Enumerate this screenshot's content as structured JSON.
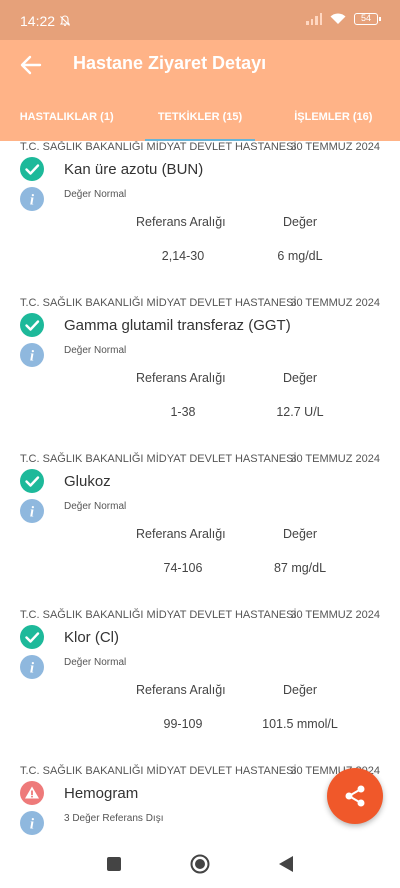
{
  "status_bar": {
    "time": "14:22",
    "battery": "54"
  },
  "header": {
    "title": "Hastane Ziyaret Detayı",
    "background": "#FFB387"
  },
  "tabs": [
    {
      "label": "HASTALIKLAR (1)",
      "active": false
    },
    {
      "label": "TETKİKLER (15)",
      "active": true
    },
    {
      "label": "İŞLEMLER (16)",
      "active": false
    }
  ],
  "labels": {
    "reference_range": "Referans Aralığı",
    "value": "Değer"
  },
  "tests": [
    {
      "hospital": "T.C. SAĞLIK BAKANLIĞI MİDYAT DEVLET HASTANESİ",
      "date": "30 TEMMUZ 2024",
      "name": "Kan üre azotu (BUN)",
      "status": "Değer Normal",
      "status_type": "normal",
      "reference_range": "2,14-30",
      "value": "6 mg/dL"
    },
    {
      "hospital": "T.C. SAĞLIK BAKANLIĞI MİDYAT DEVLET HASTANESİ",
      "date": "30 TEMMUZ 2024",
      "name": "Gamma glutamil transferaz (GGT)",
      "status": "Değer Normal",
      "status_type": "normal",
      "reference_range": "1-38",
      "value": "12.7 U/L"
    },
    {
      "hospital": "T.C. SAĞLIK BAKANLIĞI MİDYAT DEVLET HASTANESİ",
      "date": "30 TEMMUZ 2024",
      "name": "Glukoz",
      "status": "Değer Normal",
      "status_type": "normal",
      "reference_range": "74-106",
      "value": "87 mg/dL"
    },
    {
      "hospital": "T.C. SAĞLIK BAKANLIĞI MİDYAT DEVLET HASTANESİ",
      "date": "30 TEMMUZ 2024",
      "name": "Klor (Cl)",
      "status": "Değer Normal",
      "status_type": "normal",
      "reference_range": "99-109",
      "value": "101.5 mmol/L"
    },
    {
      "hospital": "T.C. SAĞLIK BAKANLIĞI MİDYAT DEVLET HASTANESİ",
      "date": "30 TEMMUZ 2024",
      "name": "Hemogram",
      "status": "3 Değer Referans Dışı",
      "status_type": "warning",
      "reference_range": "",
      "value": ""
    }
  ],
  "colors": {
    "normal_icon": "#1DB99A",
    "warning_icon": "#EE7A7A",
    "info_icon": "#8FB8DE",
    "fab": "#F0582A",
    "tab_indicator": "#69B4D6"
  },
  "icons": {
    "back": "arrow-left-icon",
    "normal": "check-circle-icon",
    "warning": "warning-icon",
    "info": "info-icon",
    "fab": "share-icon"
  }
}
